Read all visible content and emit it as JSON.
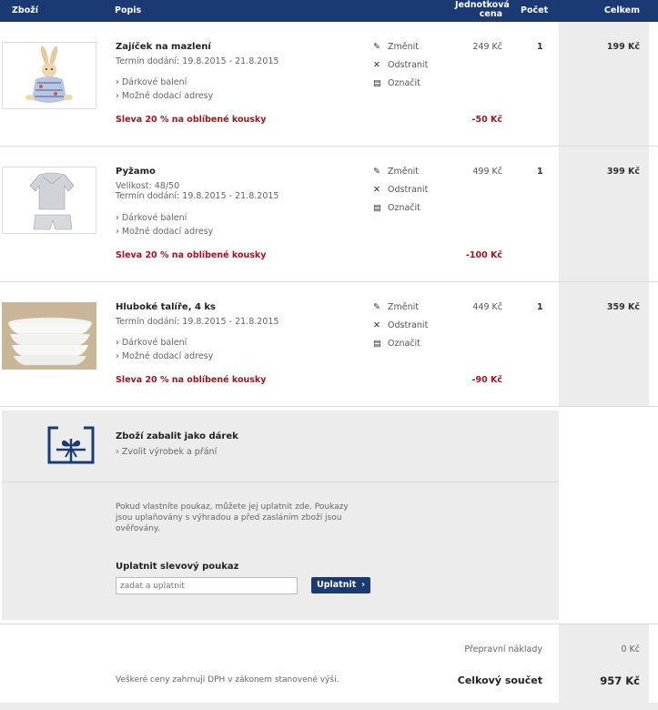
{
  "header": {
    "col_item": "Zboží",
    "col_desc": "Popis",
    "col_unit_price": "Jednotková cena",
    "col_qty": "Počet",
    "col_total": "Celkem"
  },
  "actions": {
    "change": "Změnit",
    "remove": "Odstranit",
    "mark": "Označit"
  },
  "items": [
    {
      "title": "Zajíček na mazlení",
      "size": "",
      "delivery": "Termín dodání: 19.8.2015 - 21.8.2015",
      "gift_wrap": "Dárkové balení",
      "addresses": "Možné dodací adresy",
      "discount_label": "Sleva 20 % na oblíbené kousky",
      "unit_price": "249 Kč",
      "discount_value": "-50 Kč",
      "qty": "1",
      "total": "199 Kč"
    },
    {
      "title": "Pyžamo",
      "size": "Velikost: 48/50",
      "delivery": "Termín dodání: 19.8.2015 - 21.8.2015",
      "gift_wrap": "Dárkové balení",
      "addresses": "Možné dodací adresy",
      "discount_label": "Sleva 20 % na oblíbené kousky",
      "unit_price": "499 Kč",
      "discount_value": "-100 Kč",
      "qty": "1",
      "total": "399 Kč"
    },
    {
      "title": "Hluboké talíře, 4 ks",
      "size": "",
      "delivery": "Termín dodání: 19.8.2015 - 21.8.2015",
      "gift_wrap": "Dárkové balení",
      "addresses": "Možné dodací adresy",
      "discount_label": "Sleva 20 % na oblíbené kousky",
      "unit_price": "449 Kč",
      "discount_value": "-90 Kč",
      "qty": "1",
      "total": "359 Kč"
    }
  ],
  "gift": {
    "title": "Zboží zabalit jako dárek",
    "link": "Zvolit výrobek a přání"
  },
  "coupon": {
    "text": "Pokud vlastníte poukaz, můžete jej uplatnit zde. Poukazy jsou uplaňovány s výhradou a před zasláním zboží jsou ověřovány.",
    "label": "Uplatnit slevový poukaz",
    "placeholder": "zadat a uplatnit",
    "button": "Uplatnit"
  },
  "summary": {
    "shipping_label": "Přepravní náklady",
    "shipping_value": "0 Kč",
    "vat_note": "Veškeré ceny zahrnují DPH v zákonem stanovené výši.",
    "grand_label": "Celkový součet",
    "grand_value": "957 Kč"
  },
  "colors": {
    "header_bg": "#1b3a73",
    "discount": "#a5141e",
    "panel_bg": "#ececec"
  }
}
